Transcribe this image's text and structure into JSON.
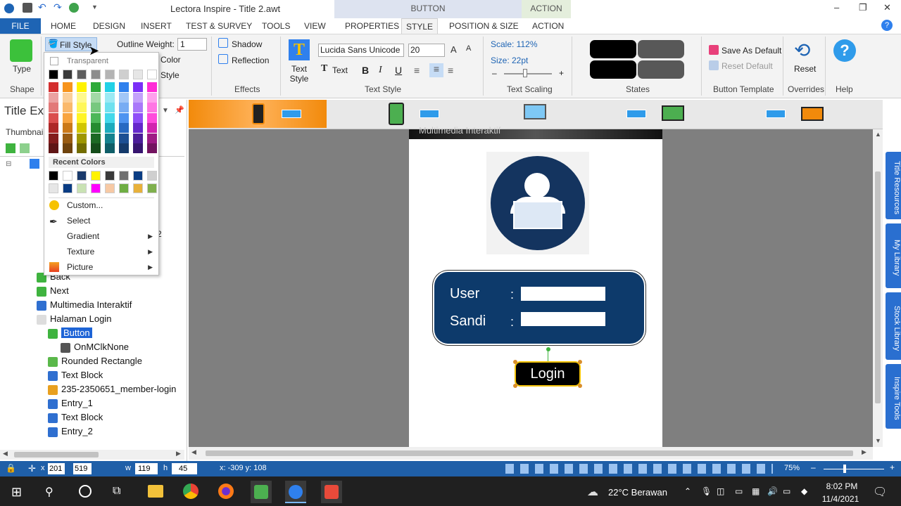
{
  "window": {
    "title": "Lectora Inspire - Title 2.awt",
    "minimize": "–",
    "maximize": "❐",
    "close": "✕"
  },
  "context_tabs": {
    "button": "BUTTON",
    "action": "ACTION"
  },
  "tabs": [
    "FILE",
    "HOME",
    "DESIGN",
    "INSERT",
    "TEST & SURVEY",
    "TOOLS",
    "VIEW",
    "PROPERTIES",
    "STYLE",
    "POSITION & SIZE",
    "ACTION"
  ],
  "ribbon": {
    "shape": {
      "label": "Type",
      "group": "Shape"
    },
    "fill_style": "Fill Style",
    "outline_weight_label": "Outline Weight:",
    "outline_weight_value": "1",
    "color_label": "Color",
    "style_label": "Style",
    "effects": {
      "shadow": "Shadow",
      "reflection": "Reflection",
      "group": "Effects"
    },
    "text_style": {
      "label": "Text Style",
      "font": "Lucida Sans Unicode",
      "size": "20",
      "text": "Text",
      "bold": "B",
      "italic": "I",
      "underline": "U",
      "group": "Text Style"
    },
    "scaling": {
      "scale": "Scale: 112%",
      "size": "Size: 22pt",
      "minus": "–",
      "plus": "+",
      "group": "Text Scaling"
    },
    "states_group": "States",
    "template": {
      "save": "Save As Default",
      "reset": "Reset Default",
      "group": "Button Template"
    },
    "overrides": {
      "reset": "Reset",
      "group": "Overrides"
    },
    "help": {
      "group": "Help"
    }
  },
  "color_menu": {
    "transparent": "Transparent",
    "recent": "Recent Colors",
    "items": [
      {
        "label": "Custom...",
        "arrow": false
      },
      {
        "label": "Select",
        "arrow": false
      },
      {
        "label": "Gradient",
        "arrow": true
      },
      {
        "label": "Texture",
        "arrow": true
      },
      {
        "label": "Picture",
        "arrow": true
      }
    ],
    "grays": [
      "#000000",
      "#3a3a3a",
      "#5e5e5e",
      "#8c8c8c",
      "#b4b4b4",
      "#cfcfcf",
      "#e6e6e6",
      "#ffffff"
    ],
    "hues": [
      "#d32f2f",
      "#f7941d",
      "#fff200",
      "#2eaa3a",
      "#22d1e6",
      "#2f80ed",
      "#7b2ff7",
      "#ff2bd6"
    ],
    "recent_colors": [
      "#000000",
      "#ffffff",
      "#1a3a6b",
      "#fff200",
      "#3a3a3a",
      "#6f6f6f",
      "#0a3c83",
      "#cfcfcf",
      "#e6e6e6",
      "#0a3c83",
      "#c9e2b3",
      "#ff00ff",
      "#f7c9a4",
      "#6fae44",
      "#e8b13a",
      "#7fb04d"
    ]
  },
  "left_panel": {
    "title": "Title Ex",
    "thumbnail": "Thumbnail",
    "partial_label": "2",
    "tree": [
      {
        "label": "Back",
        "indent": 1,
        "icon": "#3fb33f"
      },
      {
        "label": "Next",
        "indent": 1,
        "icon": "#3fb33f"
      },
      {
        "label": "Multimedia Interaktif",
        "indent": 1,
        "icon": "#2f6fd0"
      },
      {
        "label": "Halaman Login",
        "indent": 1,
        "icon": "#dddddd"
      },
      {
        "label": "Button",
        "indent": 2,
        "icon": "#3fb33f",
        "selected": true
      },
      {
        "label": "OnMClkNone",
        "indent": 3,
        "icon": "#555555"
      },
      {
        "label": "Rounded Rectangle",
        "indent": 2,
        "icon": "#5ab84a"
      },
      {
        "label": "Text Block",
        "indent": 2,
        "icon": "#2f6fd0"
      },
      {
        "label": "235-2350651_member-login",
        "indent": 2,
        "icon": "#e8a020"
      },
      {
        "label": "Entry_1",
        "indent": 2,
        "icon": "#2f6fd0"
      },
      {
        "label": "Text Block",
        "indent": 2,
        "icon": "#2f6fd0"
      },
      {
        "label": "Entry_2",
        "indent": 2,
        "icon": "#2f6fd0"
      }
    ]
  },
  "canvas": {
    "header": "Multimedia Interaktif",
    "user_label": "User",
    "sandi_label": "Sandi",
    "colon": ":",
    "login_button": "Login"
  },
  "side_tabs": [
    "Title Resources",
    "My Library",
    "Stock Library",
    "Inspire Tools"
  ],
  "statusbar": {
    "x": "x",
    "x_value": "201",
    "y_value": "519",
    "w": "w",
    "w_value": "119",
    "h": "h",
    "h_value": "45",
    "cursor": "x: -309  y: 108",
    "zoom": "75%"
  },
  "taskbar": {
    "weather": "22°C  Berawan",
    "time": "8:02 PM",
    "date": "11/4/2021"
  }
}
